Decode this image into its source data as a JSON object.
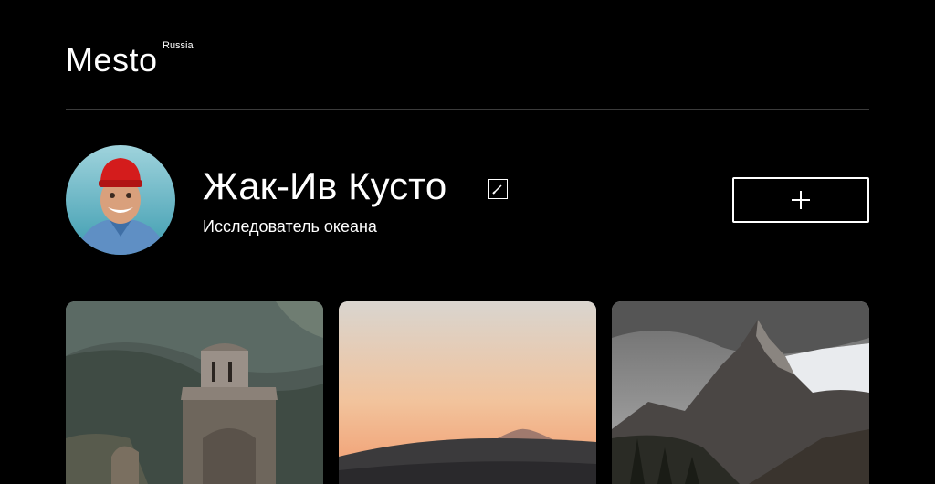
{
  "header": {
    "logo_text": "Mesto",
    "logo_sup": "Russia"
  },
  "profile": {
    "name": "Жак-Ив Кусто",
    "about": "Исследователь океана",
    "edit_icon": "pencil-icon",
    "add_icon": "plus-icon"
  },
  "cards": [
    {
      "image": "mountain-church-photo"
    },
    {
      "image": "sunset-mountain-photo"
    },
    {
      "image": "snowy-peaks-photo"
    }
  ]
}
